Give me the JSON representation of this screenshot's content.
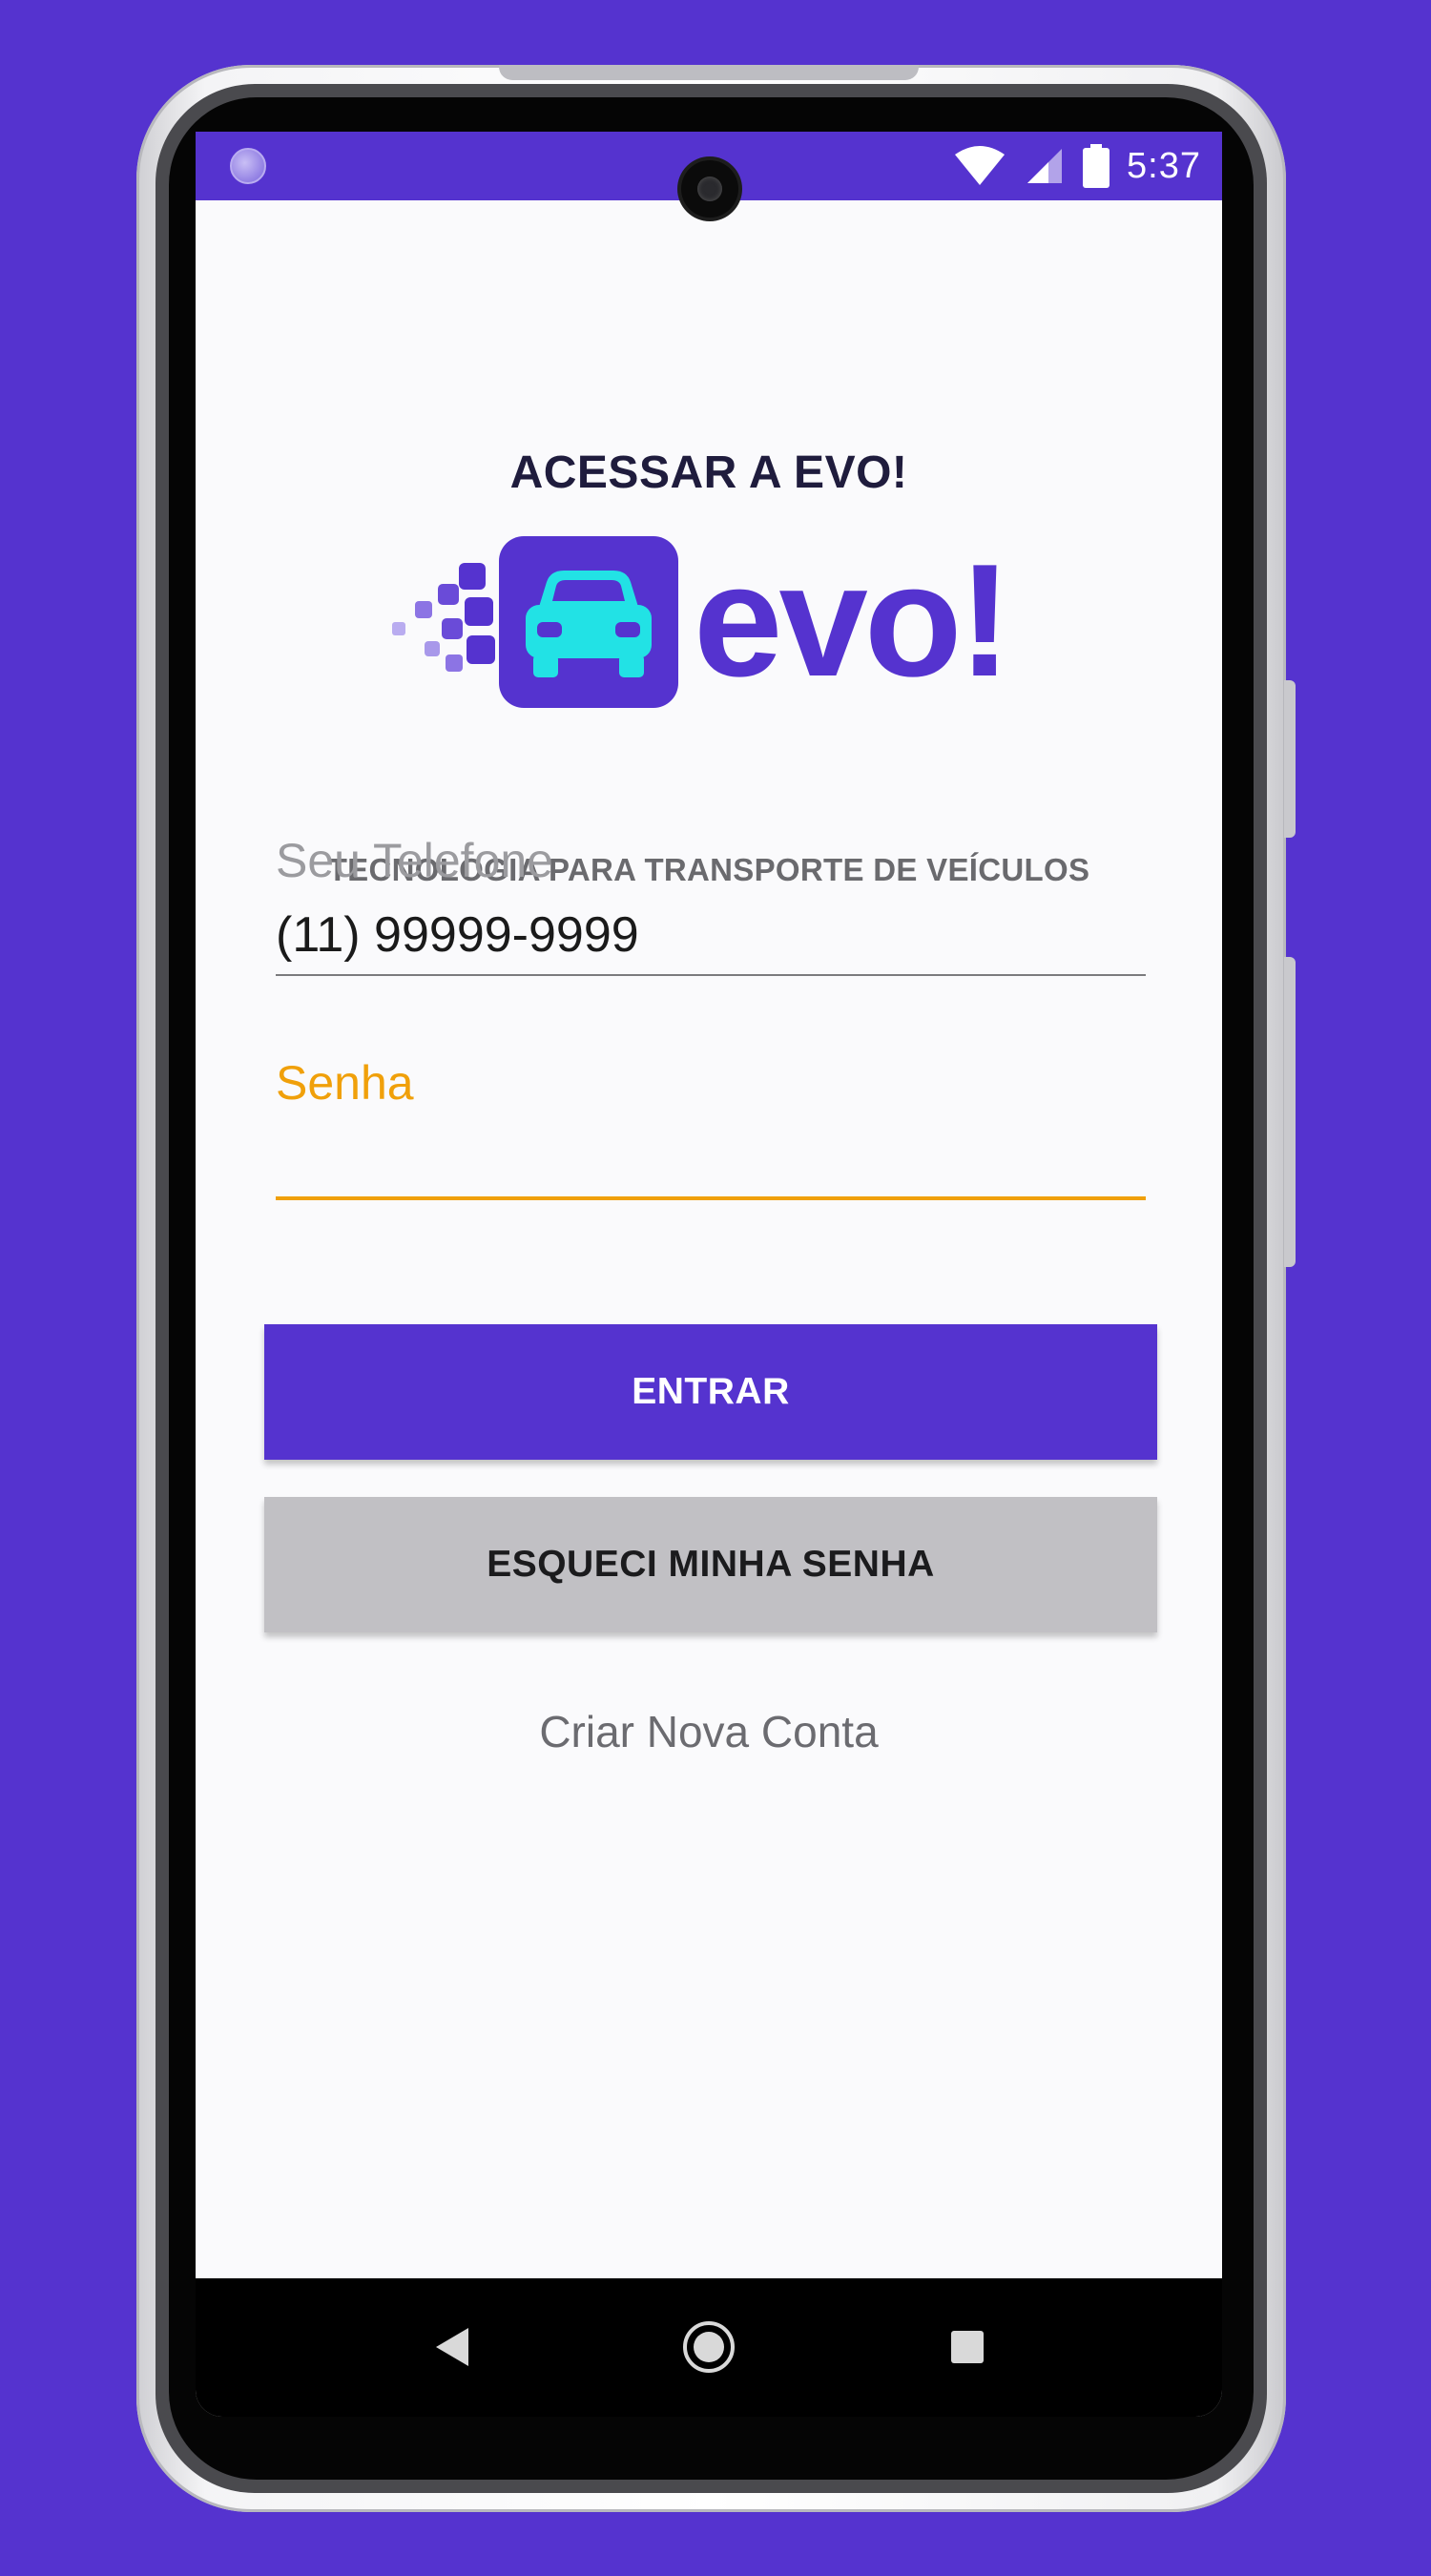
{
  "colors": {
    "brand": "#5533cf",
    "accent_focus": "#f0a00a",
    "logo_car": "#22e2e5",
    "secondary_button": "#c1c0c4"
  },
  "status_bar": {
    "time": "5:37",
    "icons": [
      "notification-icon",
      "wifi-icon",
      "signal-icon",
      "battery-icon"
    ]
  },
  "login": {
    "title": "ACESSAR A EVO!",
    "logo_text": "evo!",
    "tagline": "TECNOLOGIA PARA TRANSPORTE DE VEÍCULOS",
    "phone_field": {
      "label": "Seu Telefone",
      "value": "(11) 99999-9999"
    },
    "password_field": {
      "label": "Senha",
      "value": ""
    },
    "submit_label": "ENTRAR",
    "forgot_label": "ESQUECI MINHA SENHA",
    "create_account_label": "Criar Nova Conta"
  },
  "navigation": {
    "buttons": [
      "back-icon",
      "home-icon",
      "recents-icon"
    ]
  }
}
